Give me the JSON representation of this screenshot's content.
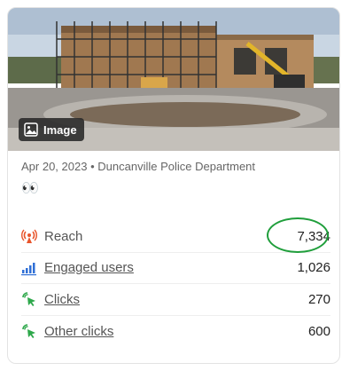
{
  "post": {
    "badge_label": "Image",
    "date": "Apr 20, 2023",
    "separator": "•",
    "page_name": "Duncanville Police Department",
    "emoji": "👀"
  },
  "metrics": [
    {
      "label": "Reach",
      "value": "7,334",
      "icon": "reach-icon",
      "link": false
    },
    {
      "label": "Engaged users",
      "value": "1,026",
      "icon": "bar-chart-icon",
      "link": true
    },
    {
      "label": "Clicks",
      "value": "270",
      "icon": "cursor-click-icon",
      "link": true
    },
    {
      "label": "Other clicks",
      "value": "600",
      "icon": "cursor-click-icon",
      "link": true
    }
  ],
  "colors": {
    "reach_icon": "#e8542a",
    "engaged_icon": "#2f6fd6",
    "click_icon": "#2ea84b",
    "highlight": "#1f9e3b"
  }
}
